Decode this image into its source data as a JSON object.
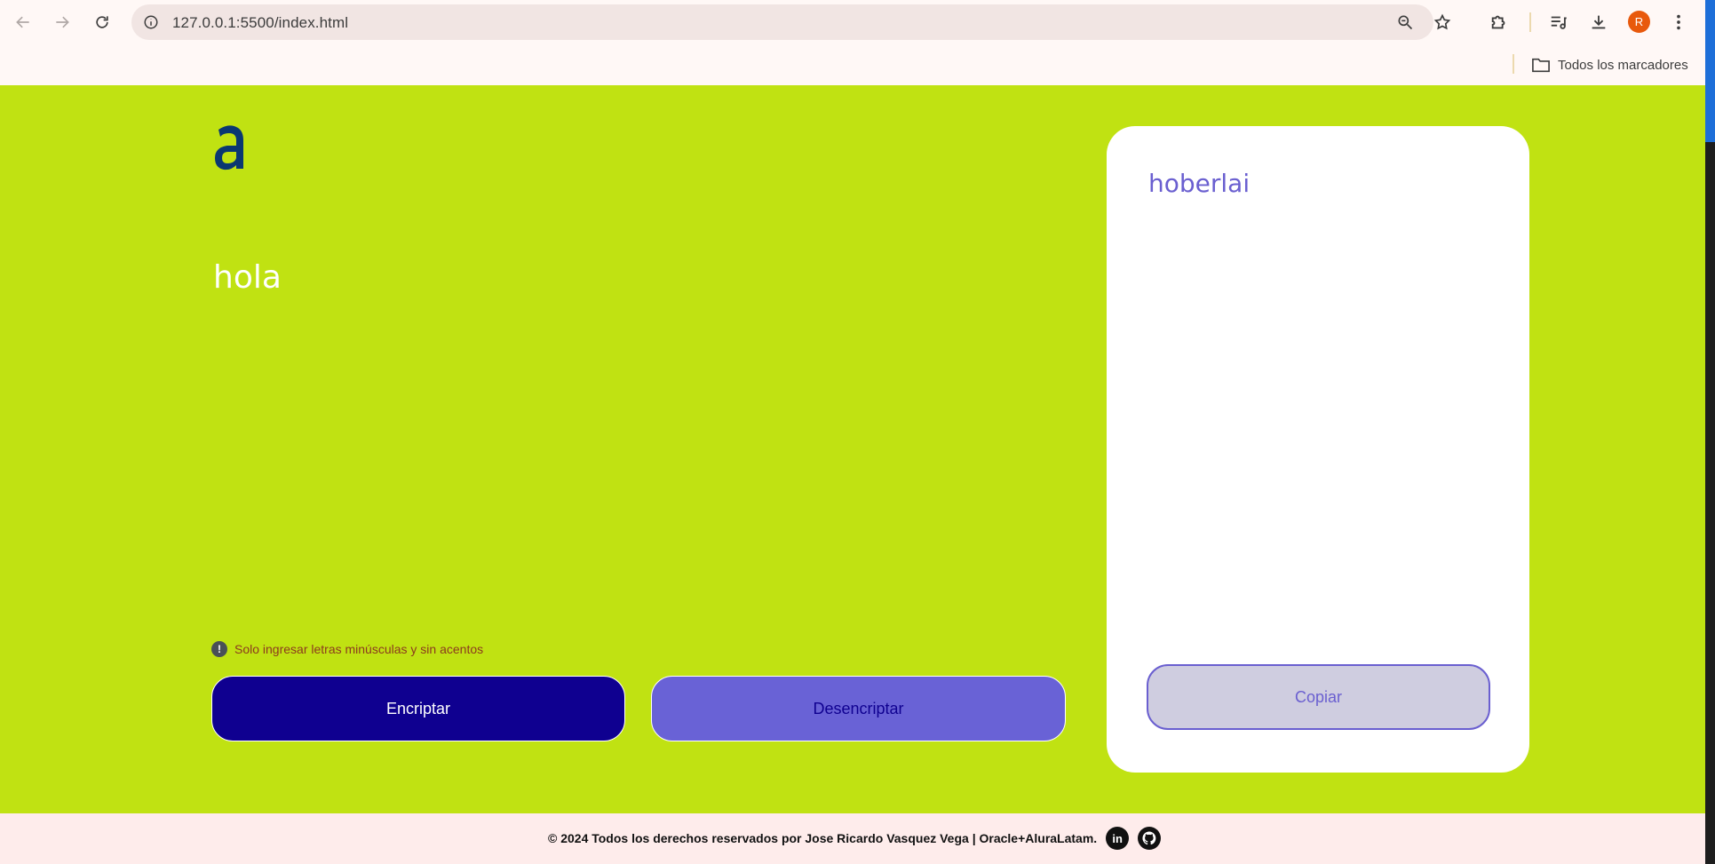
{
  "browser": {
    "url": "127.0.0.1:5500/index.html",
    "profile_initial": "R",
    "bookmarks_folder": "Todos los marcadores",
    "icons": {
      "back": "arrow-left-icon",
      "forward": "arrow-right-icon",
      "reload": "reload-icon",
      "site_info": "info-icon",
      "zoom": "zoom-icon",
      "bookmark": "star-icon",
      "extensions": "puzzle-icon",
      "media": "media-queue-icon",
      "downloads": "download-icon",
      "menu": "kebab-menu-icon"
    }
  },
  "app": {
    "logo_letter": "a",
    "input_text": "hola",
    "hint": "Solo ingresar letras minúsculas y sin acentos",
    "encrypt_label": "Encriptar",
    "decrypt_label": "Desencriptar",
    "output_text": "hoberlai",
    "copy_label": "Copiar"
  },
  "footer": {
    "text": "© 2024 Todos los derechos reservados por Jose Ricardo Vasquez Vega | Oracle+AluraLatam.",
    "linkedin_label": "in"
  },
  "colors": {
    "page_bg": "#c0e212",
    "encrypt_bg": "#0f0090",
    "decrypt_bg": "#6962d6",
    "output_accent": "#6a5fd0",
    "footer_bg": "#feeceb"
  }
}
